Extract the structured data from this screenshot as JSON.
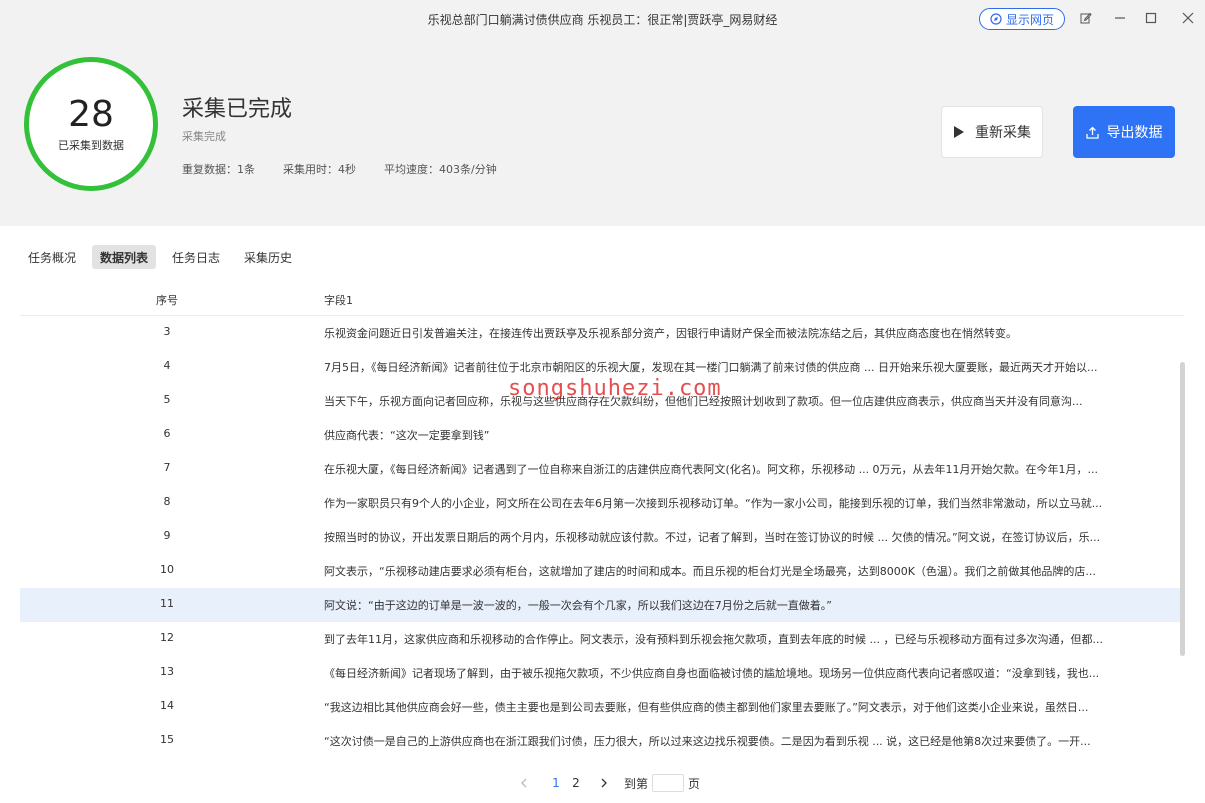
{
  "window": {
    "title": "乐视总部门口躺满讨债供应商 乐视员工：很正常|贾跃亭_网易财经",
    "show_web_label": "显示网页"
  },
  "summary": {
    "count": "28",
    "count_caption": "已采集到数据",
    "status_title": "采集已完成",
    "status_sub": "采集完成",
    "duplicate": "重复数据：1条",
    "time_used": "采集用时：4秒",
    "speed": "平均速度：403条/分钟",
    "recollect_label": "重新采集",
    "export_label": "导出数据",
    "ring_color": "#34c13a",
    "accent_color": "#2e73f5"
  },
  "tabs": [
    {
      "label": "任务概况"
    },
    {
      "label": "数据列表"
    },
    {
      "label": "任务日志"
    },
    {
      "label": "采集历史"
    }
  ],
  "table": {
    "columns": {
      "index": "序号",
      "field1": "字段1"
    },
    "rows": [
      {
        "index": "3",
        "text": "乐视资金问题近日引发普遍关注，在接连传出贾跃亭及乐视系部分资产，因银行申请财产保全而被法院冻结之后，其供应商态度也在悄然转变。"
      },
      {
        "index": "4",
        "text": "7月5日，《每日经济新闻》记者前往位于北京市朝阳区的乐视大厦，发现在其一楼门口躺满了前来讨债的供应商 ... 日开始来乐视大厦要账，最近两天才开始以..."
      },
      {
        "index": "5",
        "text": "当天下午，乐视方面向记者回应称，乐视与这些供应商存在欠款纠纷，但他们已经按照计划收到了款项。但一位店建供应商表示，供应商当天并没有同意沟..."
      },
      {
        "index": "6",
        "text": "供应商代表：“这次一定要拿到钱”"
      },
      {
        "index": "7",
        "text": "在乐视大厦，《每日经济新闻》记者遇到了一位自称来自浙江的店建供应商代表阿文(化名)。阿文称，乐视移动 ... 0万元，从去年11月开始欠款。在今年1月，..."
      },
      {
        "index": "8",
        "text": "作为一家职员只有9个人的小企业，阿文所在公司在去年6月第一次接到乐视移动订单。“作为一家小公司，能接到乐视的订单，我们当然非常激动，所以立马就..."
      },
      {
        "index": "9",
        "text": "按照当时的协议，开出发票日期后的两个月内，乐视移动就应该付款。不过，记者了解到，当时在签订协议的时候 ... 欠债的情况。”阿文说，在签订协议后，乐..."
      },
      {
        "index": "10",
        "text": "阿文表示，“乐视移动建店要求必须有柜台，这就增加了建店的时间和成本。而且乐视的柜台灯光是全场最亮，达到8000K（色温）。我们之前做其他品牌的店..."
      },
      {
        "index": "11",
        "text": "阿文说：“由于这边的订单是一波一波的，一般一次会有个几家，所以我们这边在7月份之后就一直做着。”"
      },
      {
        "index": "12",
        "text": "到了去年11月，这家供应商和乐视移动的合作停止。阿文表示，没有预料到乐视会拖欠款项，直到去年底的时候 ... ，已经与乐视移动方面有过多次沟通，但都..."
      },
      {
        "index": "13",
        "text": "《每日经济新闻》记者现场了解到，由于被乐视拖欠款项，不少供应商自身也面临被讨债的尴尬境地。现场另一位供应商代表向记者感叹道：“没拿到钱，我也..."
      },
      {
        "index": "14",
        "text": "“我这边相比其他供应商会好一些，债主主要也是到公司去要账，但有些供应商的债主都到他们家里去要账了。”阿文表示，对于他们这类小企业来说，虽然日..."
      },
      {
        "index": "15",
        "text": "“这次讨债一是自己的上游供应商也在浙江跟我们讨债，压力很大，所以过来这边找乐视要债。二是因为看到乐视 ... 说，这已经是他第8次过来要债了。一开..."
      }
    ]
  },
  "watermark": "songshuhezi.com",
  "pagination": {
    "pages": [
      "1",
      "2"
    ],
    "goto_label": "到第",
    "page_suffix": "页"
  }
}
